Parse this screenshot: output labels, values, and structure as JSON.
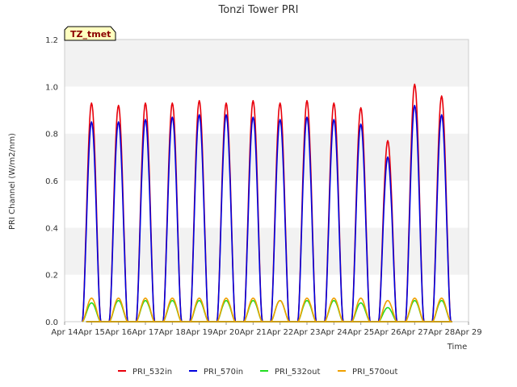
{
  "chart_data": {
    "type": "line",
    "title": "Tonzi Tower PRI",
    "xlabel": "Time",
    "ylabel": "PRI Channel (W/m2/nm)",
    "ylim": [
      0.0,
      1.2
    ],
    "xlim": [
      0,
      15
    ],
    "yticks": [
      "0.0",
      "0.2",
      "0.4",
      "0.6",
      "0.8",
      "1.0",
      "1.2"
    ],
    "xticks": [
      "Apr 14",
      "Apr 15",
      "Apr 16",
      "Apr 17",
      "Apr 18",
      "Apr 19",
      "Apr 20",
      "Apr 21",
      "Apr 22",
      "Apr 23",
      "Apr 24",
      "Apr 25",
      "Apr 26",
      "Apr 27",
      "Apr 28",
      "Apr 29"
    ],
    "grid": "horizontal alternating bands",
    "legend_position": "bottom",
    "badge": "TZ_tmet",
    "day_offset_from_apr14": [
      1,
      2,
      3,
      4,
      5,
      6,
      7,
      8,
      9,
      10,
      11,
      12,
      13,
      14
    ],
    "series": [
      {
        "name": "PRI_532in",
        "color": "#e8000b",
        "daily_peak": [
          0.93,
          0.92,
          0.93,
          0.93,
          0.94,
          0.93,
          0.94,
          0.93,
          0.94,
          0.93,
          0.91,
          0.77,
          1.01,
          0.96
        ]
      },
      {
        "name": "PRI_570in",
        "color": "#0000dd",
        "daily_peak": [
          0.85,
          0.85,
          0.86,
          0.87,
          0.88,
          0.88,
          0.87,
          0.86,
          0.87,
          0.86,
          0.84,
          0.7,
          0.92,
          0.88
        ]
      },
      {
        "name": "PRI_532out",
        "color": "#22dd22",
        "daily_peak": [
          0.08,
          0.09,
          0.09,
          0.09,
          0.09,
          0.09,
          0.09,
          0.09,
          0.09,
          0.09,
          0.08,
          0.06,
          0.09,
          0.09
        ]
      },
      {
        "name": "PRI_570out",
        "color": "#f0a000",
        "daily_peak": [
          0.1,
          0.1,
          0.1,
          0.1,
          0.1,
          0.1,
          0.1,
          0.09,
          0.1,
          0.1,
          0.1,
          0.09,
          0.1,
          0.1
        ]
      }
    ]
  }
}
